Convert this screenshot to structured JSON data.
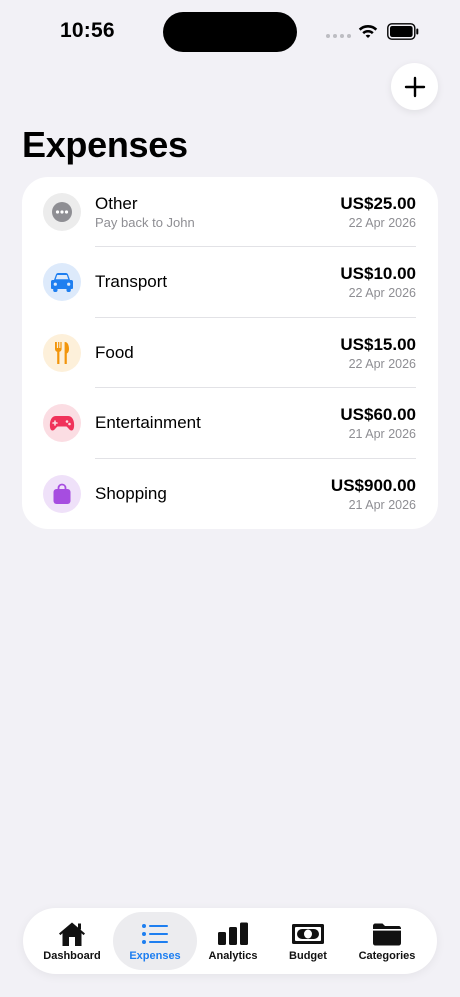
{
  "status_bar": {
    "time": "10:56"
  },
  "header": {
    "title": "Expenses"
  },
  "expenses": [
    {
      "category": "Other",
      "note": "Pay back to John",
      "amount": "US$25.00",
      "date": "22 Apr 2026",
      "icon": "ellipsis-icon",
      "color": "#8e8e93"
    },
    {
      "category": "Transport",
      "amount": "US$10.00",
      "date": "22 Apr 2026",
      "icon": "car-icon",
      "color": "#1f7ff0"
    },
    {
      "category": "Food",
      "amount": "US$15.00",
      "date": "22 Apr 2026",
      "icon": "fork-knife-icon",
      "color": "#f2950b"
    },
    {
      "category": "Entertainment",
      "amount": "US$60.00",
      "date": "21 Apr 2026",
      "icon": "gamepad-icon",
      "color": "#f0325a"
    },
    {
      "category": "Shopping",
      "amount": "US$900.00",
      "date": "21 Apr 2026",
      "icon": "bag-icon",
      "color": "#a64de0"
    }
  ],
  "tabbar": {
    "tabs": [
      {
        "label": "Dashboard",
        "icon": "house-icon"
      },
      {
        "label": "Expenses",
        "icon": "list-icon",
        "active": true
      },
      {
        "label": "Analytics",
        "icon": "bar-chart-icon"
      },
      {
        "label": "Budget",
        "icon": "banknote-icon"
      },
      {
        "label": "Categories",
        "icon": "folder-icon"
      }
    ]
  },
  "colors": {
    "accent": "#1d7ef0",
    "background": "#f2f1f6"
  }
}
